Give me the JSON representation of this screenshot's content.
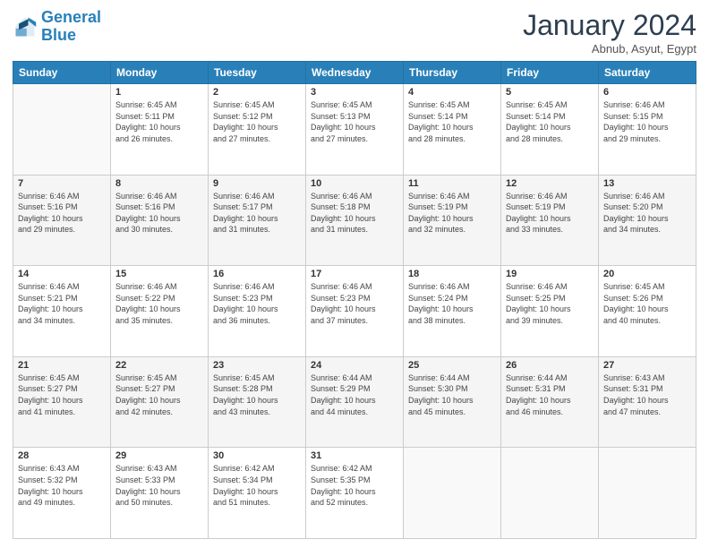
{
  "header": {
    "logo_line1": "General",
    "logo_line2": "Blue",
    "month_title": "January 2024",
    "subtitle": "Abnub, Asyut, Egypt"
  },
  "days_of_week": [
    "Sunday",
    "Monday",
    "Tuesday",
    "Wednesday",
    "Thursday",
    "Friday",
    "Saturday"
  ],
  "weeks": [
    [
      {
        "num": "",
        "info": ""
      },
      {
        "num": "1",
        "info": "Sunrise: 6:45 AM\nSunset: 5:11 PM\nDaylight: 10 hours\nand 26 minutes."
      },
      {
        "num": "2",
        "info": "Sunrise: 6:45 AM\nSunset: 5:12 PM\nDaylight: 10 hours\nand 27 minutes."
      },
      {
        "num": "3",
        "info": "Sunrise: 6:45 AM\nSunset: 5:13 PM\nDaylight: 10 hours\nand 27 minutes."
      },
      {
        "num": "4",
        "info": "Sunrise: 6:45 AM\nSunset: 5:14 PM\nDaylight: 10 hours\nand 28 minutes."
      },
      {
        "num": "5",
        "info": "Sunrise: 6:45 AM\nSunset: 5:14 PM\nDaylight: 10 hours\nand 28 minutes."
      },
      {
        "num": "6",
        "info": "Sunrise: 6:46 AM\nSunset: 5:15 PM\nDaylight: 10 hours\nand 29 minutes."
      }
    ],
    [
      {
        "num": "7",
        "info": "Sunrise: 6:46 AM\nSunset: 5:16 PM\nDaylight: 10 hours\nand 29 minutes."
      },
      {
        "num": "8",
        "info": "Sunrise: 6:46 AM\nSunset: 5:16 PM\nDaylight: 10 hours\nand 30 minutes."
      },
      {
        "num": "9",
        "info": "Sunrise: 6:46 AM\nSunset: 5:17 PM\nDaylight: 10 hours\nand 31 minutes."
      },
      {
        "num": "10",
        "info": "Sunrise: 6:46 AM\nSunset: 5:18 PM\nDaylight: 10 hours\nand 31 minutes."
      },
      {
        "num": "11",
        "info": "Sunrise: 6:46 AM\nSunset: 5:19 PM\nDaylight: 10 hours\nand 32 minutes."
      },
      {
        "num": "12",
        "info": "Sunrise: 6:46 AM\nSunset: 5:19 PM\nDaylight: 10 hours\nand 33 minutes."
      },
      {
        "num": "13",
        "info": "Sunrise: 6:46 AM\nSunset: 5:20 PM\nDaylight: 10 hours\nand 34 minutes."
      }
    ],
    [
      {
        "num": "14",
        "info": "Sunrise: 6:46 AM\nSunset: 5:21 PM\nDaylight: 10 hours\nand 34 minutes."
      },
      {
        "num": "15",
        "info": "Sunrise: 6:46 AM\nSunset: 5:22 PM\nDaylight: 10 hours\nand 35 minutes."
      },
      {
        "num": "16",
        "info": "Sunrise: 6:46 AM\nSunset: 5:23 PM\nDaylight: 10 hours\nand 36 minutes."
      },
      {
        "num": "17",
        "info": "Sunrise: 6:46 AM\nSunset: 5:23 PM\nDaylight: 10 hours\nand 37 minutes."
      },
      {
        "num": "18",
        "info": "Sunrise: 6:46 AM\nSunset: 5:24 PM\nDaylight: 10 hours\nand 38 minutes."
      },
      {
        "num": "19",
        "info": "Sunrise: 6:46 AM\nSunset: 5:25 PM\nDaylight: 10 hours\nand 39 minutes."
      },
      {
        "num": "20",
        "info": "Sunrise: 6:45 AM\nSunset: 5:26 PM\nDaylight: 10 hours\nand 40 minutes."
      }
    ],
    [
      {
        "num": "21",
        "info": "Sunrise: 6:45 AM\nSunset: 5:27 PM\nDaylight: 10 hours\nand 41 minutes."
      },
      {
        "num": "22",
        "info": "Sunrise: 6:45 AM\nSunset: 5:27 PM\nDaylight: 10 hours\nand 42 minutes."
      },
      {
        "num": "23",
        "info": "Sunrise: 6:45 AM\nSunset: 5:28 PM\nDaylight: 10 hours\nand 43 minutes."
      },
      {
        "num": "24",
        "info": "Sunrise: 6:44 AM\nSunset: 5:29 PM\nDaylight: 10 hours\nand 44 minutes."
      },
      {
        "num": "25",
        "info": "Sunrise: 6:44 AM\nSunset: 5:30 PM\nDaylight: 10 hours\nand 45 minutes."
      },
      {
        "num": "26",
        "info": "Sunrise: 6:44 AM\nSunset: 5:31 PM\nDaylight: 10 hours\nand 46 minutes."
      },
      {
        "num": "27",
        "info": "Sunrise: 6:43 AM\nSunset: 5:31 PM\nDaylight: 10 hours\nand 47 minutes."
      }
    ],
    [
      {
        "num": "28",
        "info": "Sunrise: 6:43 AM\nSunset: 5:32 PM\nDaylight: 10 hours\nand 49 minutes."
      },
      {
        "num": "29",
        "info": "Sunrise: 6:43 AM\nSunset: 5:33 PM\nDaylight: 10 hours\nand 50 minutes."
      },
      {
        "num": "30",
        "info": "Sunrise: 6:42 AM\nSunset: 5:34 PM\nDaylight: 10 hours\nand 51 minutes."
      },
      {
        "num": "31",
        "info": "Sunrise: 6:42 AM\nSunset: 5:35 PM\nDaylight: 10 hours\nand 52 minutes."
      },
      {
        "num": "",
        "info": ""
      },
      {
        "num": "",
        "info": ""
      },
      {
        "num": "",
        "info": ""
      }
    ]
  ]
}
